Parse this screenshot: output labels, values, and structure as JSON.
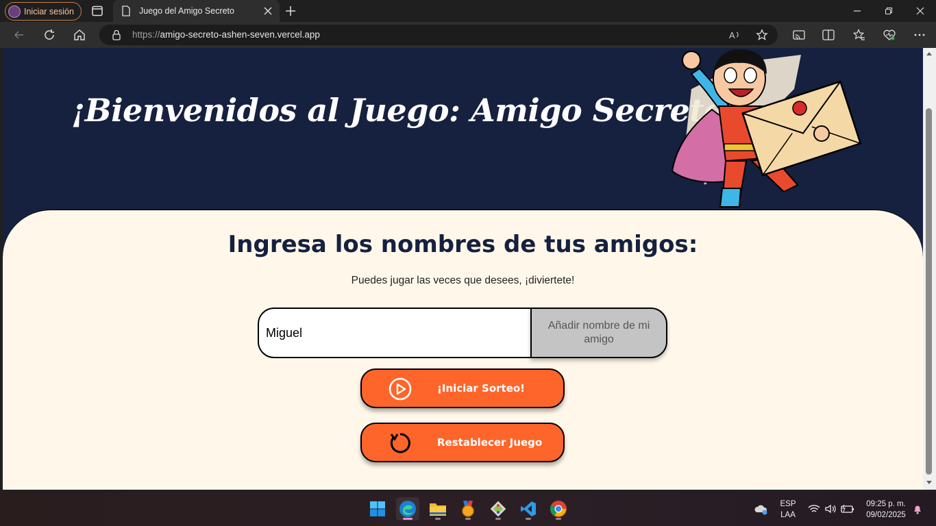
{
  "browser": {
    "profile_label": "Iniciar sesión",
    "tab_title": "Juego del Amigo Secreto",
    "url_protocol": "https://",
    "url_host": "amigo-secreto-ashen-seven.vercel.app"
  },
  "page": {
    "main_title": "¡Bienvenidos al Juego: Amigo Secreto!",
    "section_title": "Ingresa los nombres de tus amigos:",
    "subtitle": "Puedes jugar las veces que desees, ¡diviertete!",
    "name_input_value": "Miguel",
    "add_button_label": "Añadir nombre de mi amigo",
    "draw_button_label": "¡Iniciar Sorteo!",
    "reset_button_label": "Restablecer Juego"
  },
  "taskbar": {
    "lang_top": "ESP",
    "lang_bottom": "LAA",
    "time": "09:25 p. m.",
    "date": "09/02/2025"
  },
  "colors": {
    "header_bg": "#16203f",
    "panel_bg": "#fff8ea",
    "accent_orange": "#fe652b",
    "add_button_bg": "#c4c4c4"
  }
}
